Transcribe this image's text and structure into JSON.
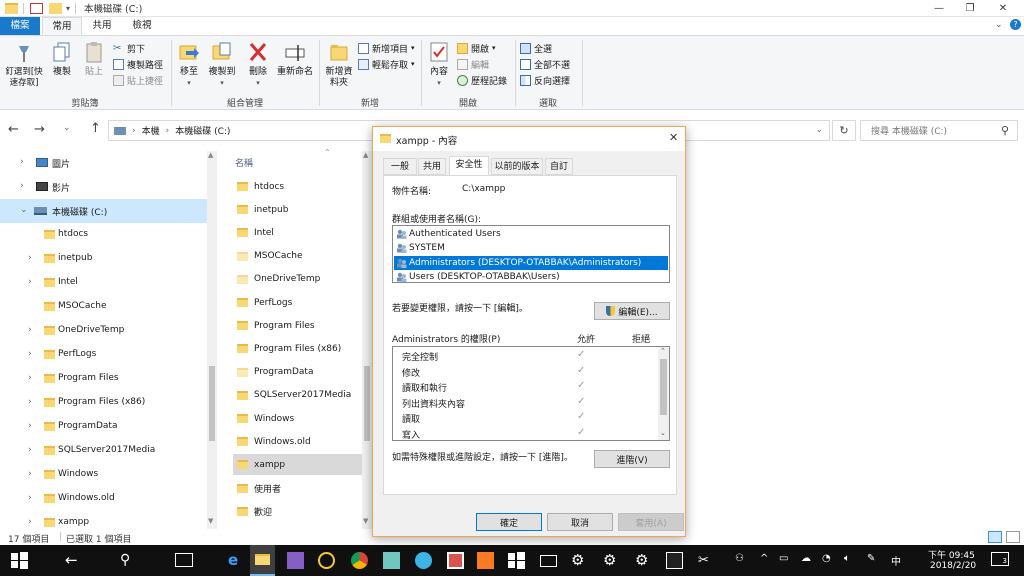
{
  "window": {
    "title": "本機磁碟 (C:)",
    "controls": {
      "minimize": "—",
      "maximize": "❐",
      "close": "✕"
    }
  },
  "ribbon_tabs": [
    {
      "label": "檔案",
      "active": false,
      "file_tab": true
    },
    {
      "label": "常用",
      "active": true
    },
    {
      "label": "共用",
      "active": false
    },
    {
      "label": "檢視",
      "active": false
    }
  ],
  "ribbon": {
    "clipboard": {
      "label": "剪貼簿",
      "pin": "釘選到[快速存取]",
      "copy": "複製",
      "paste": "貼上",
      "cut": "剪下",
      "copy_path": "複製路徑",
      "paste_shortcut": "貼上捷徑"
    },
    "organize": {
      "label": "組合管理",
      "move_to": "移至",
      "copy_to": "複製到",
      "delete": "刪除",
      "rename": "重新命名"
    },
    "new": {
      "label": "新增",
      "new_folder": "新增資料夾",
      "new_item": "新增項目",
      "easy_access": "輕鬆存取"
    },
    "open": {
      "label": "開啟",
      "properties": "內容",
      "open": "開啟",
      "edit": "編輯",
      "history": "歷程記錄"
    },
    "select": {
      "label": "選取",
      "select_all": "全選",
      "select_none": "全部不選",
      "invert": "反向選擇"
    }
  },
  "address": {
    "crumbs": [
      "本機",
      "本機磁碟 (C:)"
    ],
    "search_placeholder": "搜尋 本機磁碟 (C:)"
  },
  "nav_pane": {
    "items": [
      {
        "label": "圖片",
        "indent": 1,
        "expandable": true,
        "icon": "pictures-icon"
      },
      {
        "label": "影片",
        "indent": 1,
        "expandable": true,
        "icon": "videos-icon"
      },
      {
        "label": "本機磁碟 (C:)",
        "indent": 1,
        "expanded": true,
        "selected": true,
        "icon": "drive-icon"
      },
      {
        "label": "htdocs",
        "indent": 2,
        "expandable": false
      },
      {
        "label": "inetpub",
        "indent": 2,
        "expandable": true
      },
      {
        "label": "Intel",
        "indent": 2,
        "expandable": true
      },
      {
        "label": "MSOCache",
        "indent": 2,
        "expandable": false
      },
      {
        "label": "OneDriveTemp",
        "indent": 2,
        "expandable": true
      },
      {
        "label": "PerfLogs",
        "indent": 2,
        "expandable": true
      },
      {
        "label": "Program Files",
        "indent": 2,
        "expandable": true
      },
      {
        "label": "Program Files (x86)",
        "indent": 2,
        "expandable": true
      },
      {
        "label": "ProgramData",
        "indent": 2,
        "expandable": true
      },
      {
        "label": "SQLServer2017Media",
        "indent": 2,
        "expandable": true
      },
      {
        "label": "Windows",
        "indent": 2,
        "expandable": true
      },
      {
        "label": "Windows.old",
        "indent": 2,
        "expandable": true
      },
      {
        "label": "xampp",
        "indent": 2,
        "expandable": true
      }
    ]
  },
  "content": {
    "column_header": "名稱",
    "files": [
      {
        "name": "htdocs",
        "faded": false
      },
      {
        "name": "inetpub",
        "faded": false
      },
      {
        "name": "Intel",
        "faded": false
      },
      {
        "name": "MSOCache",
        "faded": true
      },
      {
        "name": "OneDriveTemp",
        "faded": true
      },
      {
        "name": "PerfLogs",
        "faded": false
      },
      {
        "name": "Program Files",
        "faded": false
      },
      {
        "name": "Program Files (x86)",
        "faded": false
      },
      {
        "name": "ProgramData",
        "faded": true
      },
      {
        "name": "SQLServer2017Media",
        "faded": false
      },
      {
        "name": "Windows",
        "faded": false
      },
      {
        "name": "Windows.old",
        "faded": false
      },
      {
        "name": "xampp",
        "faded": false,
        "selected": true
      },
      {
        "name": "使用者",
        "faded": false
      },
      {
        "name": "歡迎",
        "faded": false
      }
    ]
  },
  "status_bar": {
    "item_count": "17 個項目",
    "selected": "已選取 1 個項目"
  },
  "dialog": {
    "title": "xampp - 內容",
    "tabs": [
      {
        "label": "一般",
        "active": false
      },
      {
        "label": "共用",
        "active": false
      },
      {
        "label": "安全性",
        "active": true
      },
      {
        "label": "以前的版本",
        "active": false
      },
      {
        "label": "自訂",
        "active": false
      }
    ],
    "object_name_label": "物件名稱:",
    "object_name_value": "C:\\xampp",
    "groups_label": "群組或使用者名稱(G):",
    "groups": [
      {
        "name": "Authenticated Users",
        "selected": false
      },
      {
        "name": "SYSTEM",
        "selected": false
      },
      {
        "name": "Administrators (DESKTOP-OTABBAK\\Administrators)",
        "selected": true
      },
      {
        "name": "Users (DESKTOP-OTABBAK\\Users)",
        "selected": false
      }
    ],
    "change_hint": "若要變更權限，請按一下 [編輯]。",
    "edit_button": "編輯(E)...",
    "perms_label": "Administrators 的權限(P)",
    "allow_header": "允許",
    "deny_header": "拒絕",
    "permissions": [
      {
        "name": "完全控制",
        "allow": true,
        "deny": false
      },
      {
        "name": "修改",
        "allow": true,
        "deny": false
      },
      {
        "name": "讀取和執行",
        "allow": true,
        "deny": false
      },
      {
        "name": "列出資料夾內容",
        "allow": true,
        "deny": false
      },
      {
        "name": "讀取",
        "allow": true,
        "deny": false
      },
      {
        "name": "寫入",
        "allow": true,
        "deny": false
      }
    ],
    "advanced_hint": "如需特殊權限或進階設定，請按一下 [進階]。",
    "advanced_button": "進階(V)",
    "ok_button": "確定",
    "cancel_button": "取消",
    "apply_button": "套用(A)"
  },
  "taskbar": {
    "tray_ime": "中",
    "time": "下午 09:45",
    "date": "2018/2/20",
    "notification_count": "3"
  },
  "colors": {
    "file_tab": "#1979ca",
    "selection": "#cce8ff",
    "list_selected": "#0078d7",
    "folder": "#f8d775",
    "dialog_border": "#f0a858",
    "taskbar": "#101010"
  }
}
